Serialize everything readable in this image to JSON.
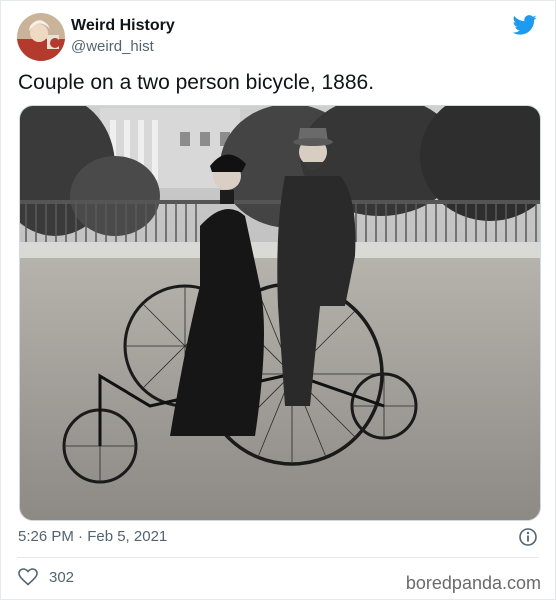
{
  "author": {
    "display_name": "Weird History",
    "handle": "@weird_hist",
    "avatar_icon": "avatar-portrait"
  },
  "tweet": {
    "text": "Couple on a two person bicycle, 1886.",
    "timestamp": "5:26 PM · Feb 5, 2021",
    "like_count": "302"
  },
  "icons": {
    "brand": "twitter-bird-icon",
    "info": "info-circle-icon",
    "like": "heart-outline-icon"
  },
  "watermark": "boredpanda.com",
  "colors": {
    "twitter_blue": "#1d9bf0",
    "secondary_text": "#536471",
    "primary_text": "#0f1419"
  }
}
